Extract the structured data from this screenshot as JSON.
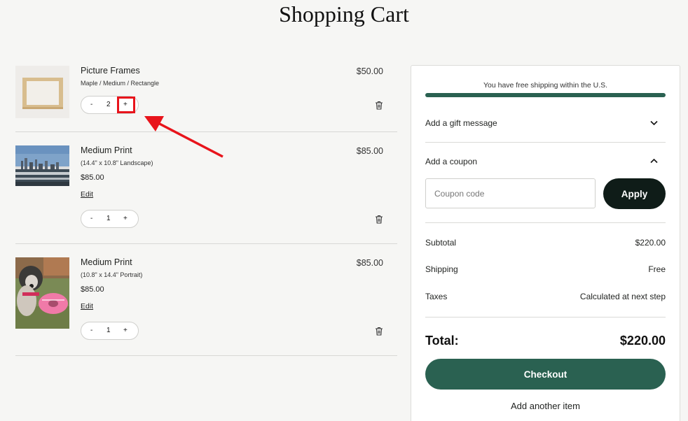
{
  "page": {
    "title": "Shopping Cart"
  },
  "cart": {
    "items": [
      {
        "name": "Picture Frames",
        "variant": "Maple / Medium / Rectangle",
        "quantity": "2",
        "price": "$50.00"
      },
      {
        "name": "Medium Print",
        "variant": "(14.4\" x 10.8\" Landscape)",
        "unit_price": "$85.00",
        "edit_label": "Edit",
        "quantity": "1",
        "price": "$85.00"
      },
      {
        "name": "Medium Print",
        "variant": "(10.8\" x 14.4\" Portrait)",
        "unit_price": "$85.00",
        "edit_label": "Edit",
        "quantity": "1",
        "price": "$85.00"
      }
    ],
    "stepper": {
      "minus": "-",
      "plus": "+"
    }
  },
  "summary": {
    "shipping_message": "You have free shipping within the U.S.",
    "shipping_progress": 1.0,
    "gift_label": "Add a gift message",
    "coupon_label": "Add a coupon",
    "coupon_placeholder": "Coupon code",
    "apply_label": "Apply",
    "subtotal_label": "Subtotal",
    "subtotal_value": "$220.00",
    "shipping_label": "Shipping",
    "shipping_value": "Free",
    "taxes_label": "Taxes",
    "taxes_value": "Calculated at next step",
    "total_label": "Total:",
    "total_value": "$220.00",
    "checkout_label": "Checkout",
    "add_another_label": "Add another item"
  },
  "colors": {
    "accent": "#2a6151",
    "apply_bg": "#0f1c18",
    "annotation": "#e8141b"
  },
  "icons": [
    "trash-icon",
    "chevron-down-icon",
    "chevron-up-icon",
    "annotation-arrow-icon"
  ]
}
